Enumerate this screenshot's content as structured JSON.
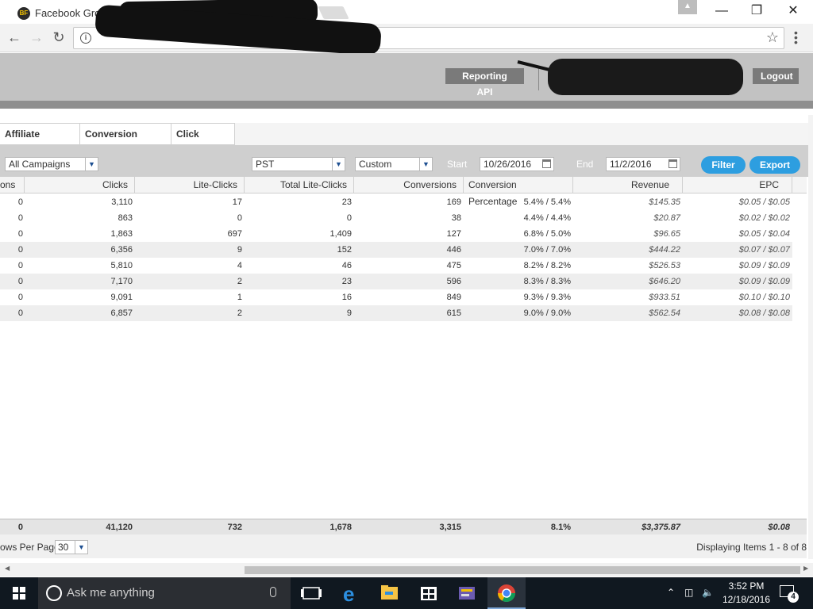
{
  "browser": {
    "tab_title": "Facebook Groups Ma",
    "favicon_text": "BF",
    "window_controls": {
      "minimize": "—",
      "restore": "❐",
      "close": "✕"
    }
  },
  "header": {
    "reporting_api_label": "Reporting API",
    "logout_label": "Logout"
  },
  "report_tabs": [
    "Affiliate Summary",
    "Conversion Report",
    "Click Report"
  ],
  "filters": {
    "campaign": "All Campaigns",
    "timezone": "PST",
    "range": "Custom",
    "start_label": "Start",
    "start_date": "10/26/2016",
    "end_label": "End",
    "end_date": "11/2/2016",
    "filter_label": "Filter",
    "export_label": "Export"
  },
  "table": {
    "columns": [
      "ons",
      "Clicks",
      "Lite-Clicks",
      "Total Lite-Clicks",
      "Conversions",
      "Conversion Percentage",
      "Revenue",
      "EPC"
    ],
    "rows": [
      [
        "0",
        "3,110",
        "17",
        "23",
        "169",
        "5.4% / 5.4%",
        "$145.35",
        "$0.05 / $0.05"
      ],
      [
        "0",
        "863",
        "0",
        "0",
        "38",
        "4.4% / 4.4%",
        "$20.87",
        "$0.02 / $0.02"
      ],
      [
        "0",
        "1,863",
        "697",
        "1,409",
        "127",
        "6.8% / 5.0%",
        "$96.65",
        "$0.05 / $0.04"
      ],
      [
        "0",
        "6,356",
        "9",
        "152",
        "446",
        "7.0% / 7.0%",
        "$444.22",
        "$0.07 / $0.07"
      ],
      [
        "0",
        "5,810",
        "4",
        "46",
        "475",
        "8.2% / 8.2%",
        "$526.53",
        "$0.09 / $0.09"
      ],
      [
        "0",
        "7,170",
        "2",
        "23",
        "596",
        "8.3% / 8.3%",
        "$646.20",
        "$0.09 / $0.09"
      ],
      [
        "0",
        "9,091",
        "1",
        "16",
        "849",
        "9.3% / 9.3%",
        "$933.51",
        "$0.10 / $0.10"
      ],
      [
        "0",
        "6,857",
        "2",
        "9",
        "615",
        "9.0% / 9.0%",
        "$562.54",
        "$0.08 / $0.08"
      ]
    ],
    "totals": [
      "0",
      "41,120",
      "732",
      "1,678",
      "3,315",
      "8.1%",
      "$3,375.87",
      "$0.08"
    ]
  },
  "pager": {
    "rows_per_page_label": "ows Per Page:",
    "rows_per_page": "30",
    "info": "Displaying Items 1 - 8 of 8"
  },
  "taskbar": {
    "search_placeholder": "Ask me anything",
    "time": "3:52 PM",
    "date": "12/18/2016",
    "notification_count": "4"
  }
}
